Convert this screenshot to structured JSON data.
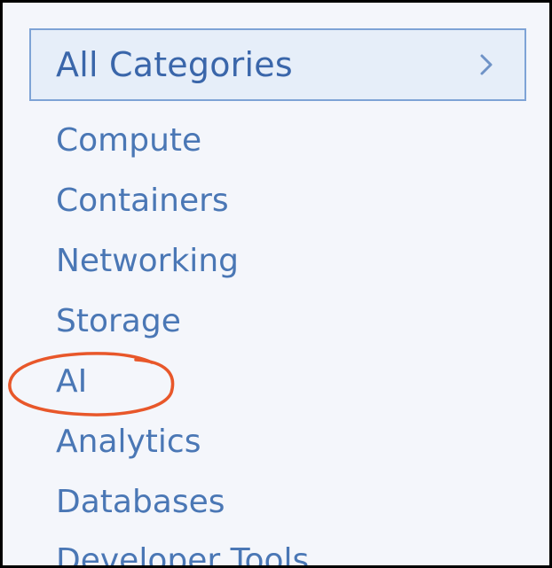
{
  "all_categories": {
    "label": "All Categories",
    "chevron_icon": "chevron-right-icon"
  },
  "menu": {
    "items": [
      {
        "label": "Compute"
      },
      {
        "label": "Containers"
      },
      {
        "label": "Networking"
      },
      {
        "label": "Storage"
      },
      {
        "label": "AI"
      },
      {
        "label": "Analytics"
      },
      {
        "label": "Databases"
      },
      {
        "label": "Developer Tools"
      }
    ]
  },
  "annotation": {
    "type": "hand-drawn-ellipse",
    "target": "AI",
    "color": "#e8572a"
  },
  "colors": {
    "accent": "#3a66aa",
    "link": "#4a77b5",
    "panel_background": "#f4f6fb",
    "header_background": "#e6eef9",
    "header_border": "#7ea3d6"
  }
}
